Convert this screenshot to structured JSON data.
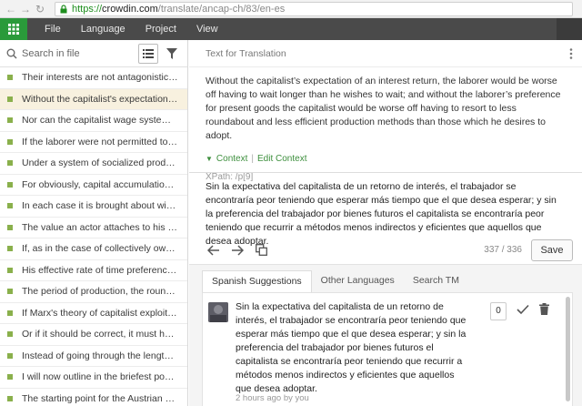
{
  "browser": {
    "url_https": "https://",
    "url_host": "crowdin.com",
    "url_path": "/translate/ancap-ch/83/en-es"
  },
  "appbar": {
    "menu": [
      "File",
      "Language",
      "Project",
      "View"
    ]
  },
  "left": {
    "search_placeholder": "Search in file",
    "strings": [
      "Their interests are not antagonistic but harmonious.",
      "Without the capitalist's expectation of an interest return",
      "Nor can the capitalist wage system be regarded as exploitation",
      "If the laborer were not permitted to sell his labor",
      "Under a system of socialized production, the worker",
      "For obviously, capital accumulation must precede",
      "In each case it is brought about with the aid",
      "The value an actor attaches to his capital goods",
      "If, as in the case of collectively owned factories",
      "His effective rate of time preference will be",
      "The period of production, the roundabout method",
      "If Marx's theory of capitalist exploitation were true",
      "Or if it should be correct, it must have been",
      "Instead of going through the lengthier task",
      "I will now outline in the briefest possible manner",
      "The starting point for the Austrian exploitation theory"
    ]
  },
  "source": {
    "header": "Text for Translation",
    "text": "Without the capitalist’s expectation of an interest return, the laborer would be worse off having to wait longer than he wishes to wait; and without the laborer’s preference for present goods the capitalist would be worse off having to resort to less roundabout and less efficient production methods than those which he desires to adopt.",
    "context_label": "Context",
    "edit_context_label": "Edit Context",
    "xpath": "XPath: /p[9]"
  },
  "translation": {
    "text": "Sin la expectativa del capitalista de un retorno de interés, el trabajador se encontraría peor teniendo que esperar más tiempo que el que desea esperar; y sin la preferencia del trabajador por bienes futuros el capitalista se encontraría peor teniendo que recurrir a métodos menos indirectos y eficientes que aquellos que desea adoptar.",
    "char_count": "337 / 336",
    "save_label": "Save"
  },
  "suggestions": {
    "tabs": [
      "Spanish Suggestions",
      "Other Languages",
      "Search TM"
    ],
    "item": {
      "text": "Sin la expectativa del capitalista de un retorno de interés, el trabajador se encontraría peor teniendo que esperar más tiempo que el que desea esperar; y sin la preferencia del trabajador por bienes futuros el capitalista se encontraría peor teniendo que recurrir a métodos menos indirectos y eficientes que aquellos que desea adoptar.",
      "meta": "2 hours ago by you",
      "votes": "0"
    }
  },
  "colors": {
    "accent_green": "#2a9a3a",
    "status_green": "#8ab04c",
    "appbar_bg": "#4a4a4a",
    "active_row_bg": "#f8f1df"
  }
}
